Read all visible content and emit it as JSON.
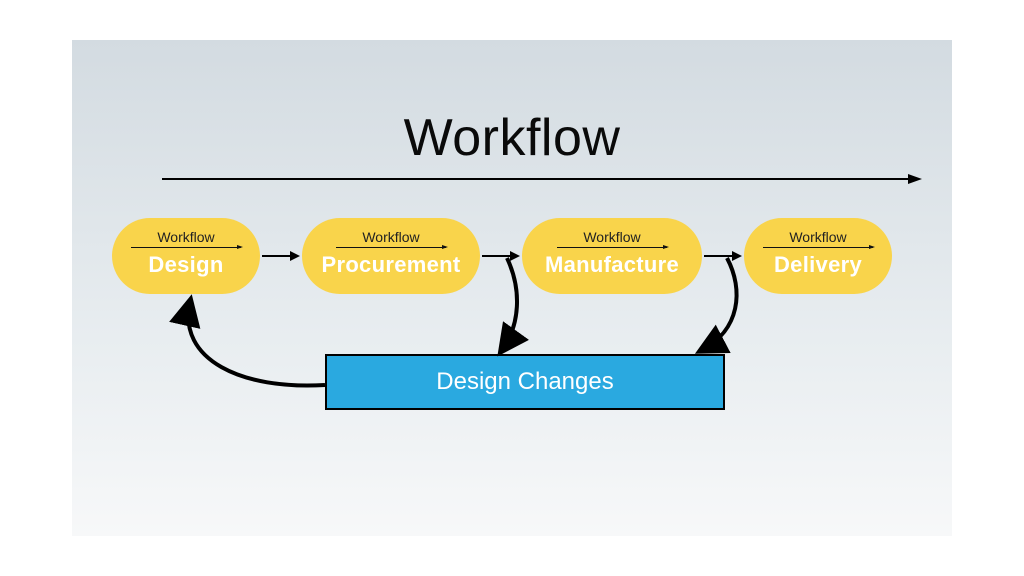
{
  "diagram": {
    "title": "Workflow",
    "stage_sublabel": "Workflow",
    "stages": {
      "design": "Design",
      "procurement": "Procurement",
      "manufacture": "Manufacture",
      "delivery": "Delivery"
    },
    "changes_box": "Design Changes"
  }
}
